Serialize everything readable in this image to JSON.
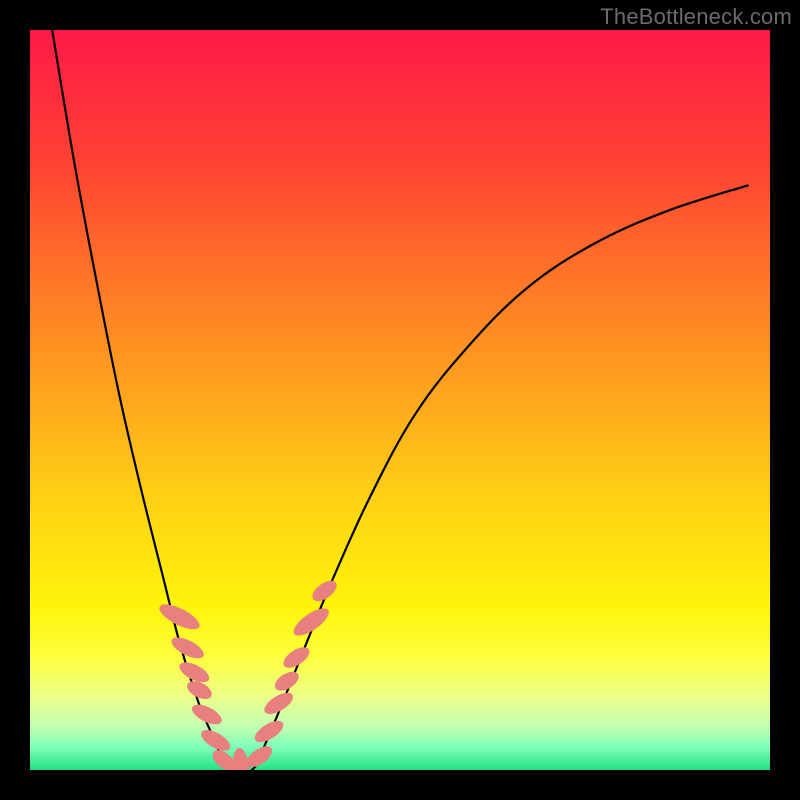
{
  "watermark": "TheBottleneck.com",
  "chart_data": {
    "type": "line",
    "title": "",
    "xlabel": "",
    "ylabel": "",
    "xlim": [
      0,
      1
    ],
    "ylim": [
      0,
      1
    ],
    "series": [
      {
        "name": "left-branch",
        "x": [
          0.03,
          0.06,
          0.09,
          0.12,
          0.15,
          0.18,
          0.2,
          0.215,
          0.23,
          0.245,
          0.258,
          0.27
        ],
        "y": [
          1.0,
          0.82,
          0.66,
          0.51,
          0.38,
          0.26,
          0.18,
          0.13,
          0.085,
          0.05,
          0.02,
          0.0
        ]
      },
      {
        "name": "valley-floor",
        "x": [
          0.27,
          0.3
        ],
        "y": [
          0.0,
          0.0
        ]
      },
      {
        "name": "right-branch",
        "x": [
          0.3,
          0.32,
          0.345,
          0.375,
          0.41,
          0.46,
          0.52,
          0.59,
          0.67,
          0.76,
          0.86,
          0.97
        ],
        "y": [
          0.0,
          0.04,
          0.1,
          0.175,
          0.26,
          0.37,
          0.48,
          0.57,
          0.65,
          0.71,
          0.755,
          0.79
        ]
      }
    ],
    "markers": [
      {
        "x": 0.202,
        "y": 0.207,
        "rx": 0.011,
        "ry": 0.03,
        "angle": -63
      },
      {
        "x": 0.213,
        "y": 0.165,
        "rx": 0.01,
        "ry": 0.024,
        "angle": -63
      },
      {
        "x": 0.222,
        "y": 0.132,
        "rx": 0.01,
        "ry": 0.022,
        "angle": -63
      },
      {
        "x": 0.229,
        "y": 0.108,
        "rx": 0.01,
        "ry": 0.018,
        "angle": -63
      },
      {
        "x": 0.239,
        "y": 0.075,
        "rx": 0.01,
        "ry": 0.022,
        "angle": -63
      },
      {
        "x": 0.251,
        "y": 0.04,
        "rx": 0.01,
        "ry": 0.022,
        "angle": -60
      },
      {
        "x": 0.262,
        "y": 0.013,
        "rx": 0.01,
        "ry": 0.018,
        "angle": -50
      },
      {
        "x": 0.285,
        "y": 0.002,
        "rx": 0.011,
        "ry": 0.028,
        "angle": -5
      },
      {
        "x": 0.31,
        "y": 0.018,
        "rx": 0.01,
        "ry": 0.02,
        "angle": 55
      },
      {
        "x": 0.323,
        "y": 0.052,
        "rx": 0.01,
        "ry": 0.022,
        "angle": 58
      },
      {
        "x": 0.336,
        "y": 0.09,
        "rx": 0.01,
        "ry": 0.022,
        "angle": 58
      },
      {
        "x": 0.347,
        "y": 0.12,
        "rx": 0.01,
        "ry": 0.018,
        "angle": 58
      },
      {
        "x": 0.36,
        "y": 0.152,
        "rx": 0.01,
        "ry": 0.02,
        "angle": 56
      },
      {
        "x": 0.38,
        "y": 0.2,
        "rx": 0.011,
        "ry": 0.028,
        "angle": 55
      },
      {
        "x": 0.398,
        "y": 0.242,
        "rx": 0.01,
        "ry": 0.019,
        "angle": 54
      }
    ],
    "marker_color": "#e98080"
  }
}
